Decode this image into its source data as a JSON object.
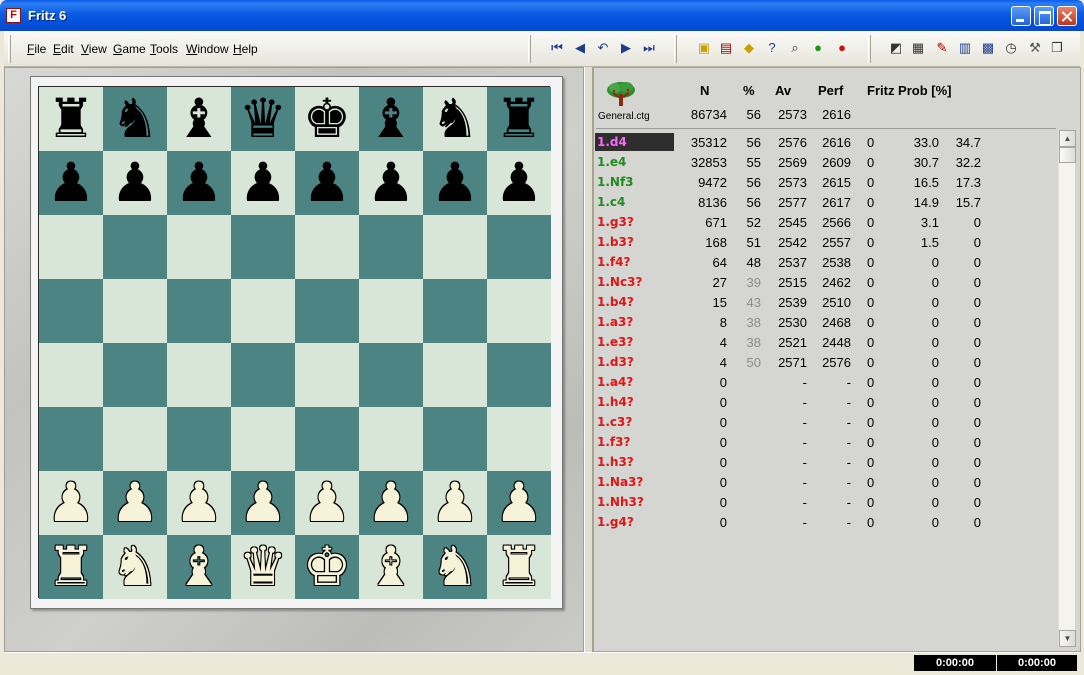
{
  "window": {
    "title": "Fritz 6",
    "icon": "fritz-app-icon"
  },
  "menu": [
    "File",
    "Edit",
    "View",
    "Game",
    "Tools",
    "Window",
    "Help"
  ],
  "toolbar_nav": [
    "first-move-icon",
    "previous-move-icon",
    "take-back-icon",
    "next-move-icon",
    "last-move-icon"
  ],
  "toolbar_actions": [
    "open-folder-icon",
    "save-game-icon",
    "hint-icon",
    "help-question-icon",
    "analysis-icon",
    "accept-check-icon",
    "stop-icon"
  ],
  "toolbar_right": [
    "board-icon",
    "database-icon",
    "notation-edit-icon",
    "windows-layout-icon",
    "engine-window-icon",
    "clock-icon",
    "tools-icon",
    "copy-icon"
  ],
  "board": {
    "ranks": [
      [
        "br",
        "bn",
        "bb",
        "bq",
        "bk",
        "bb",
        "bn",
        "br"
      ],
      [
        "bp",
        "bp",
        "bp",
        "bp",
        "bp",
        "bp",
        "bp",
        "bp"
      ],
      [
        "",
        "",
        "",
        "",
        "",
        "",
        "",
        ""
      ],
      [
        "",
        "",
        "",
        "",
        "",
        "",
        "",
        ""
      ],
      [
        "",
        "",
        "",
        "",
        "",
        "",
        "",
        ""
      ],
      [
        "",
        "",
        "",
        "",
        "",
        "",
        "",
        ""
      ],
      [
        "wp",
        "wp",
        "wp",
        "wp",
        "wp",
        "wp",
        "wp",
        "wp"
      ],
      [
        "wr",
        "wn",
        "wb",
        "wq",
        "wk",
        "wb",
        "wn",
        "wr"
      ]
    ],
    "light_color": "#D7E6D7",
    "dark_color": "#4C8484"
  },
  "opening_book": {
    "file": "General.ctg",
    "headers": {
      "n": "N",
      "pct": "%",
      "av": "Av",
      "perf": "Perf",
      "fritz_prob": "Fritz Prob [%]"
    },
    "totals": {
      "n": "86734",
      "pct": "56",
      "av": "2573",
      "perf": "2616"
    },
    "colors": {
      "selected": "#FF66FF",
      "good": "#1E8C1E",
      "bad": "#E01515",
      "faded": "#8C8C8C"
    },
    "moves": [
      {
        "move": "1.d4",
        "kind": "selected",
        "n": "35312",
        "pct": "56",
        "pct_faded": false,
        "av": "2576",
        "perf": "2616",
        "fritz": "0",
        "p1": "33.0",
        "p2": "34.7"
      },
      {
        "move": "1.e4",
        "kind": "good",
        "n": "32853",
        "pct": "55",
        "pct_faded": false,
        "av": "2569",
        "perf": "2609",
        "fritz": "0",
        "p1": "30.7",
        "p2": "32.2"
      },
      {
        "move": "1.Nf3",
        "kind": "good",
        "n": "9472",
        "pct": "56",
        "pct_faded": false,
        "av": "2573",
        "perf": "2615",
        "fritz": "0",
        "p1": "16.5",
        "p2": "17.3"
      },
      {
        "move": "1.c4",
        "kind": "good",
        "n": "8136",
        "pct": "56",
        "pct_faded": false,
        "av": "2577",
        "perf": "2617",
        "fritz": "0",
        "p1": "14.9",
        "p2": "15.7"
      },
      {
        "move": "1.g3?",
        "kind": "bad",
        "n": "671",
        "pct": "52",
        "pct_faded": false,
        "av": "2545",
        "perf": "2566",
        "fritz": "0",
        "p1": "3.1",
        "p2": "0"
      },
      {
        "move": "1.b3?",
        "kind": "bad",
        "n": "168",
        "pct": "51",
        "pct_faded": false,
        "av": "2542",
        "perf": "2557",
        "fritz": "0",
        "p1": "1.5",
        "p2": "0"
      },
      {
        "move": "1.f4?",
        "kind": "bad",
        "n": "64",
        "pct": "48",
        "pct_faded": false,
        "av": "2537",
        "perf": "2538",
        "fritz": "0",
        "p1": "0",
        "p2": "0"
      },
      {
        "move": "1.Nc3?",
        "kind": "bad",
        "n": "27",
        "pct": "39",
        "pct_faded": true,
        "av": "2515",
        "perf": "2462",
        "fritz": "0",
        "p1": "0",
        "p2": "0"
      },
      {
        "move": "1.b4?",
        "kind": "bad",
        "n": "15",
        "pct": "43",
        "pct_faded": true,
        "av": "2539",
        "perf": "2510",
        "fritz": "0",
        "p1": "0",
        "p2": "0"
      },
      {
        "move": "1.a3?",
        "kind": "bad",
        "n": "8",
        "pct": "38",
        "pct_faded": true,
        "av": "2530",
        "perf": "2468",
        "fritz": "0",
        "p1": "0",
        "p2": "0"
      },
      {
        "move": "1.e3?",
        "kind": "bad",
        "n": "4",
        "pct": "38",
        "pct_faded": true,
        "av": "2521",
        "perf": "2448",
        "fritz": "0",
        "p1": "0",
        "p2": "0"
      },
      {
        "move": "1.d3?",
        "kind": "bad",
        "n": "4",
        "pct": "50",
        "pct_faded": true,
        "av": "2571",
        "perf": "2576",
        "fritz": "0",
        "p1": "0",
        "p2": "0"
      },
      {
        "move": "1.a4?",
        "kind": "bad",
        "n": "0",
        "pct": "",
        "pct_faded": false,
        "av": "-",
        "perf": "-",
        "fritz": "0",
        "p1": "0",
        "p2": "0"
      },
      {
        "move": "1.h4?",
        "kind": "bad",
        "n": "0",
        "pct": "",
        "pct_faded": false,
        "av": "-",
        "perf": "-",
        "fritz": "0",
        "p1": "0",
        "p2": "0"
      },
      {
        "move": "1.c3?",
        "kind": "bad",
        "n": "0",
        "pct": "",
        "pct_faded": false,
        "av": "-",
        "perf": "-",
        "fritz": "0",
        "p1": "0",
        "p2": "0"
      },
      {
        "move": "1.f3?",
        "kind": "bad",
        "n": "0",
        "pct": "",
        "pct_faded": false,
        "av": "-",
        "perf": "-",
        "fritz": "0",
        "p1": "0",
        "p2": "0"
      },
      {
        "move": "1.h3?",
        "kind": "bad",
        "n": "0",
        "pct": "",
        "pct_faded": false,
        "av": "-",
        "perf": "-",
        "fritz": "0",
        "p1": "0",
        "p2": "0"
      },
      {
        "move": "1.Na3?",
        "kind": "bad",
        "n": "0",
        "pct": "",
        "pct_faded": false,
        "av": "-",
        "perf": "-",
        "fritz": "0",
        "p1": "0",
        "p2": "0"
      },
      {
        "move": "1.Nh3?",
        "kind": "bad",
        "n": "0",
        "pct": "",
        "pct_faded": false,
        "av": "-",
        "perf": "-",
        "fritz": "0",
        "p1": "0",
        "p2": "0"
      },
      {
        "move": "1.g4?",
        "kind": "bad",
        "n": "0",
        "pct": "",
        "pct_faded": false,
        "av": "-",
        "perf": "-",
        "fritz": "0",
        "p1": "0",
        "p2": "0"
      }
    ]
  },
  "clocks": {
    "white": "0:00:00",
    "black": "0:00:00"
  }
}
